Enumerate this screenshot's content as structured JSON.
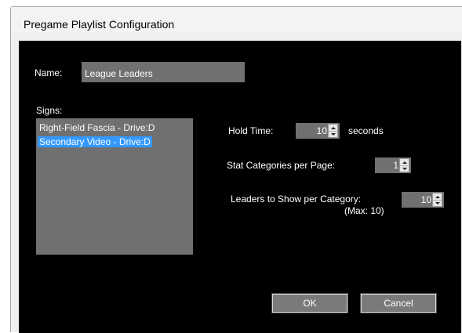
{
  "window": {
    "title": "Pregame Playlist Configuration"
  },
  "form": {
    "name_label": "Name:",
    "name_value": "League Leaders",
    "signs_label": "Signs:",
    "signs": [
      {
        "label": "Right-Field Fascia - Drive:D",
        "selected": false
      },
      {
        "label": "Secondary Video - Drive:D",
        "selected": true
      }
    ],
    "hold_time_label": "Hold Time:",
    "hold_time_value": "10",
    "hold_time_unit": "seconds",
    "stat_categories_label": "Stat Categories per Page:",
    "stat_categories_value": "1",
    "leaders_label": "Leaders to Show per Category:",
    "leaders_max": "(Max: 10)",
    "leaders_value": "10"
  },
  "buttons": {
    "ok": "OK",
    "cancel": "Cancel"
  },
  "icons": {
    "spin_up": "spin-up-icon",
    "spin_down": "spin-down-icon"
  },
  "colors": {
    "background": "#000000",
    "field": "#707070",
    "selection": "#3399ff",
    "text": "#ffffff",
    "button": "#7a7a7a"
  }
}
